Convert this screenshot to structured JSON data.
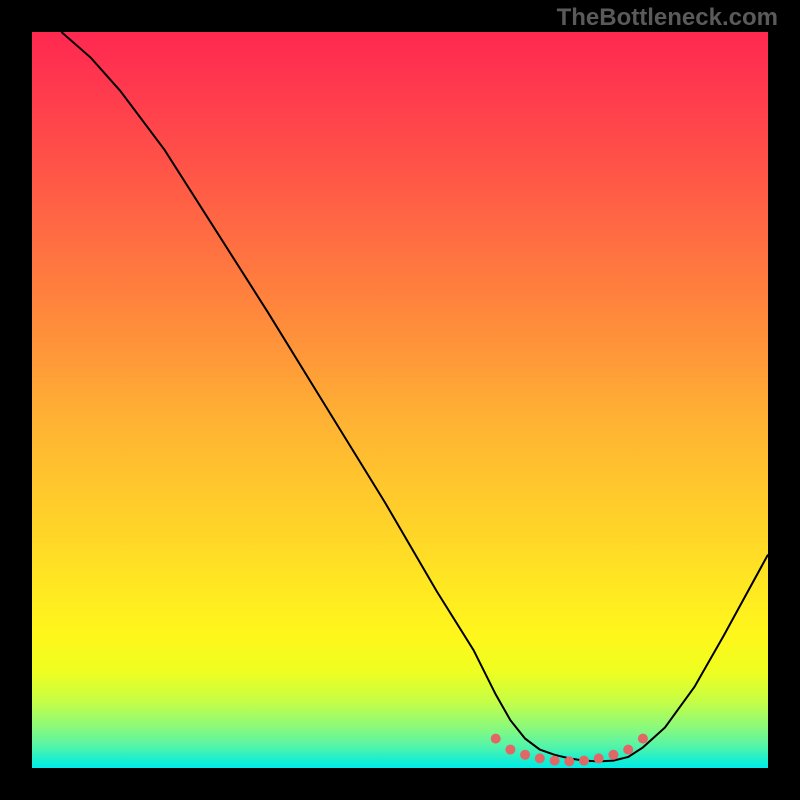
{
  "watermark": "TheBottleneck.com",
  "chart_data": {
    "type": "line",
    "title": "",
    "xlabel": "",
    "ylabel": "",
    "xlim": [
      0,
      100
    ],
    "ylim": [
      0,
      100
    ],
    "series": [
      {
        "name": "curve",
        "x": [
          4,
          8,
          12,
          18,
          25,
          32,
          40,
          48,
          55,
          60,
          63,
          65,
          67,
          69,
          71,
          73,
          75,
          77,
          79,
          81,
          83,
          86,
          90,
          94,
          97,
          100
        ],
        "y": [
          100,
          96.5,
          92,
          84,
          73,
          62,
          49,
          36,
          24,
          16,
          10,
          6.5,
          4,
          2.5,
          1.8,
          1.3,
          1.0,
          0.9,
          1.0,
          1.5,
          2.8,
          5.5,
          11,
          18,
          23.5,
          29
        ]
      }
    ],
    "markers": {
      "name": "bottom-dots",
      "x": [
        63,
        65,
        67,
        69,
        71,
        73,
        75,
        77,
        79,
        81,
        83
      ],
      "y": [
        4,
        2.5,
        1.8,
        1.3,
        1.0,
        0.9,
        1.0,
        1.3,
        1.8,
        2.5,
        4
      ],
      "color": "#e36666",
      "radius": 5
    },
    "gradient_background": {
      "top": "#ff2850",
      "middle": "#ffd528",
      "bottom": "#00ebe8"
    },
    "curve_color": "#000000",
    "curve_width": 2
  }
}
